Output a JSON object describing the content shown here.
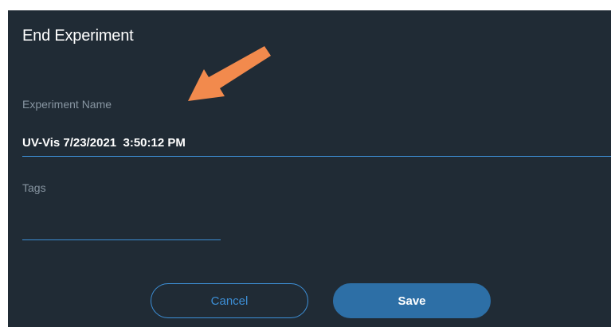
{
  "dialog": {
    "title": "End Experiment",
    "experiment_name": {
      "label": "Experiment Name",
      "value": "UV-Vis 7/23/2021  3:50:12 PM"
    },
    "tags": {
      "label": "Tags",
      "value": ""
    },
    "buttons": {
      "cancel_label": "Cancel",
      "save_label": "Save"
    }
  },
  "colors": {
    "dialog_background": "#202b35",
    "accent": "#3d8fd6",
    "primary_button": "#2d6fa6",
    "annotation_arrow": "#f28a4d"
  },
  "annotation": {
    "icon": "arrow-icon"
  }
}
